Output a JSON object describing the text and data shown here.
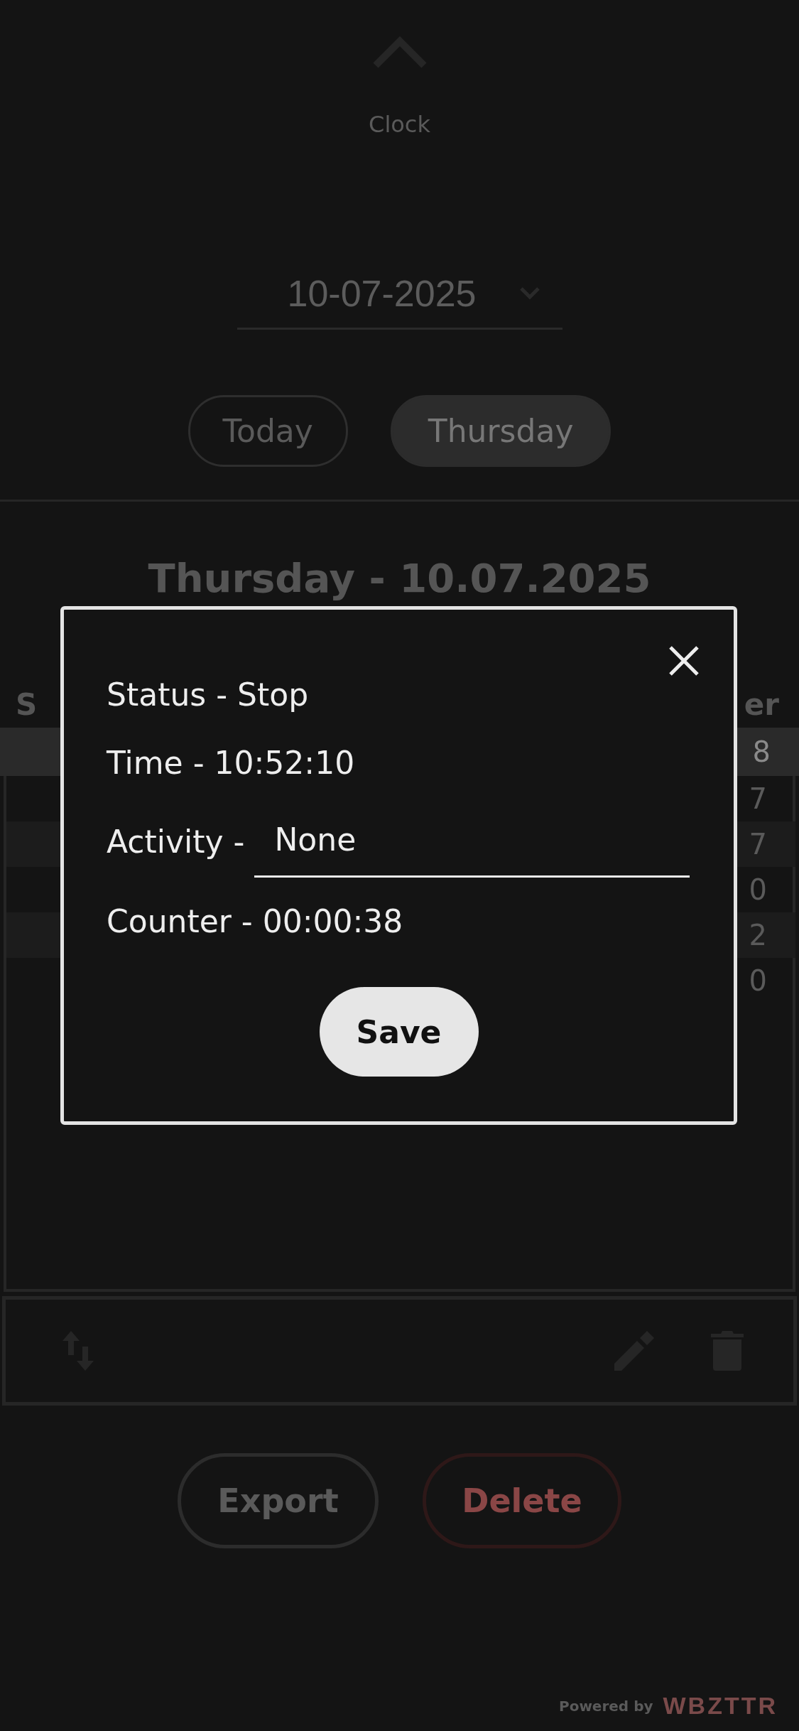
{
  "header": {
    "title": "Clock"
  },
  "date_field": {
    "value": "10-07-2025"
  },
  "day_buttons": [
    {
      "label": "Today",
      "selected": false
    },
    {
      "label": "Thursday",
      "selected": true
    }
  ],
  "heading": "Thursday - 10.07.2025",
  "table": {
    "columns": [
      "S",
      "er"
    ],
    "rows": [
      {
        "cell": "8",
        "selected": true
      },
      {
        "cell": "7",
        "selected": false
      },
      {
        "cell": "7",
        "selected": false
      },
      {
        "cell": "0",
        "selected": false
      },
      {
        "cell": "2",
        "selected": false
      },
      {
        "cell": "0",
        "selected": false
      }
    ]
  },
  "actions": [
    {
      "label": "Export",
      "kind": "neutral"
    },
    {
      "label": "Delete",
      "kind": "danger"
    }
  ],
  "footer": {
    "powered_by": "Powered by",
    "brand": "WBZTTR"
  },
  "dialog": {
    "status": "Status - Stop",
    "time": "Time - 10:52:10",
    "activity_label": "Activity -",
    "activity_value": "None",
    "counter": "Counter - 00:00:38",
    "save": "Save"
  }
}
